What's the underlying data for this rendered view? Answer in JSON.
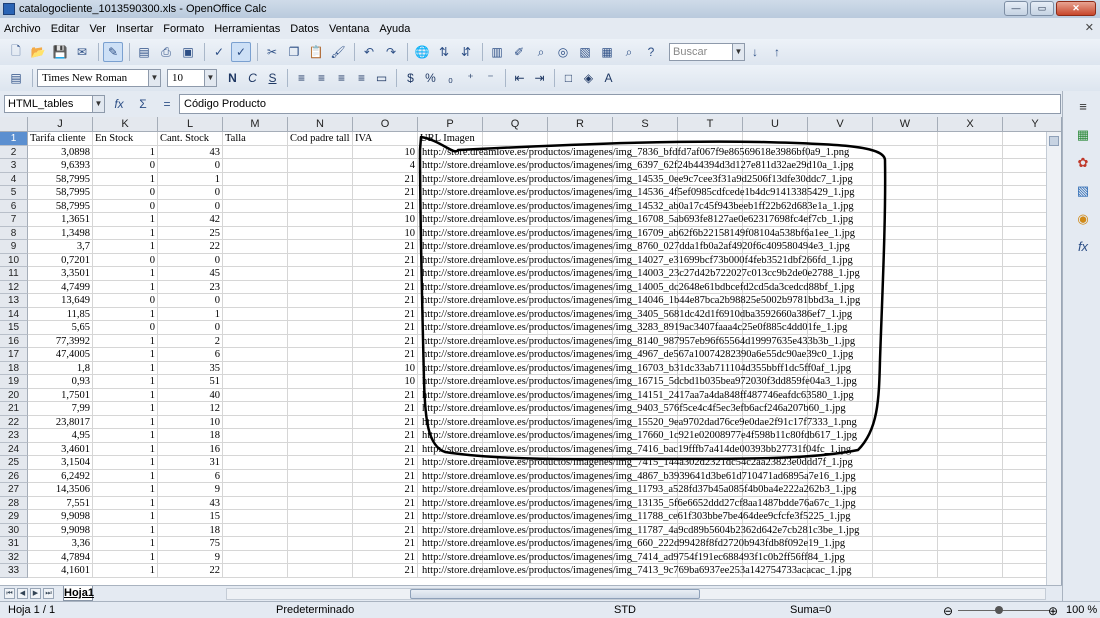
{
  "window": {
    "title": "catalogocliente_1013590300.xls - OpenOffice Calc",
    "minimize_label": "—",
    "maximize_label": "▭",
    "close_label": "✕"
  },
  "menu": {
    "items": [
      "Archivo",
      "Editar",
      "Ver",
      "Insertar",
      "Formato",
      "Herramientas",
      "Datos",
      "Ventana",
      "Ayuda"
    ],
    "close_label": "✕"
  },
  "toolbar": {
    "search_placeholder": "Buscar",
    "font_name": "Times New Roman",
    "font_size": "10",
    "bold_label": "N",
    "italic_label": "C",
    "underline_label": "S"
  },
  "formula_bar": {
    "name_box": "HTML_tables",
    "fx_label": "fx",
    "sum_label": "Σ",
    "equals_label": "=",
    "content": "Código Producto"
  },
  "columns": [
    "J",
    "K",
    "L",
    "M",
    "N",
    "O",
    "P",
    "Q",
    "R",
    "S",
    "T",
    "U",
    "V",
    "W",
    "X",
    "Y"
  ],
  "header_row": {
    "row_number": "1",
    "tarifa": "Tarifa cliente",
    "en_stock": "En Stock",
    "cant_stock": "Cant. Stock",
    "talla": "Talla",
    "cod_padre": "Cod padre tall",
    "iva": "IVA",
    "url": "URL Imagen"
  },
  "rows": [
    {
      "n": "2",
      "tarifa": "3,0898",
      "en_stock": "1",
      "cant": "43",
      "iva": "10",
      "url": "http://store.dreamlove.es/productos/imagenes/img_7836_bfdfd7af067f9e86569618e3986bf0a9_1.png"
    },
    {
      "n": "3",
      "tarifa": "9,6393",
      "en_stock": "0",
      "cant": "0",
      "iva": "4",
      "url": "http://store.dreamlove.es/productos/imagenes/img_6397_62f24b44394d3d127e811d32ae29d10a_1.jpg"
    },
    {
      "n": "4",
      "tarifa": "58,7995",
      "en_stock": "1",
      "cant": "1",
      "iva": "21",
      "url": "http://store.dreamlove.es/productos/imagenes/img_14535_0ee9c7cee3f31a9d2506f13dfe30ddc7_1.jpg"
    },
    {
      "n": "5",
      "tarifa": "58,7995",
      "en_stock": "0",
      "cant": "0",
      "iva": "21",
      "url": "http://store.dreamlove.es/productos/imagenes/img_14536_4f5ef0985cdfcede1b4dc91413385429_1.jpg"
    },
    {
      "n": "6",
      "tarifa": "58,7995",
      "en_stock": "0",
      "cant": "0",
      "iva": "21",
      "url": "http://store.dreamlove.es/productos/imagenes/img_14532_ab0a17c45f943beeb1ff22b62d683e1a_1.jpg"
    },
    {
      "n": "7",
      "tarifa": "1,3651",
      "en_stock": "1",
      "cant": "42",
      "iva": "10",
      "url": "http://store.dreamlove.es/productos/imagenes/img_16708_5ab693fe8127ae0e62317698fc4ef7cb_1.jpg"
    },
    {
      "n": "8",
      "tarifa": "1,3498",
      "en_stock": "1",
      "cant": "25",
      "iva": "10",
      "url": "http://store.dreamlove.es/productos/imagenes/img_16709_ab62f6b22158149f08104a538bf6a1ee_1.jpg"
    },
    {
      "n": "9",
      "tarifa": "3,7",
      "en_stock": "1",
      "cant": "22",
      "iva": "21",
      "url": "http://store.dreamlove.es/productos/imagenes/img_8760_027dda1fb0a2af4920f6c409580494e3_1.jpg"
    },
    {
      "n": "10",
      "tarifa": "0,7201",
      "en_stock": "0",
      "cant": "0",
      "iva": "21",
      "url": "http://store.dreamlove.es/productos/imagenes/img_14027_e31699bcf73b000f4feb3521dbf266fd_1.jpg"
    },
    {
      "n": "11",
      "tarifa": "3,3501",
      "en_stock": "1",
      "cant": "45",
      "iva": "21",
      "url": "http://store.dreamlove.es/productos/imagenes/img_14003_23c27d42b722027c013cc9b2de0e2788_1.jpg"
    },
    {
      "n": "12",
      "tarifa": "4,7499",
      "en_stock": "1",
      "cant": "23",
      "iva": "21",
      "url": "http://store.dreamlove.es/productos/imagenes/img_14005_dc2648e61bdbcefd2cd5da3cedcd88bf_1.jpg"
    },
    {
      "n": "13",
      "tarifa": "13,649",
      "en_stock": "0",
      "cant": "0",
      "iva": "21",
      "url": "http://store.dreamlove.es/productos/imagenes/img_14046_1b44e87bca2b98825e5002b9781bbd3a_1.jpg"
    },
    {
      "n": "14",
      "tarifa": "11,85",
      "en_stock": "1",
      "cant": "1",
      "iva": "21",
      "url": "http://store.dreamlove.es/productos/imagenes/img_3405_5681dc42d1f6910dba3592660a386ef7_1.jpg"
    },
    {
      "n": "15",
      "tarifa": "5,65",
      "en_stock": "0",
      "cant": "0",
      "iva": "21",
      "url": "http://store.dreamlove.es/productos/imagenes/img_3283_8919ac3407faaa4c25e0f885c4dd01fe_1.jpg"
    },
    {
      "n": "16",
      "tarifa": "77,3992",
      "en_stock": "1",
      "cant": "2",
      "iva": "21",
      "url": "http://store.dreamlove.es/productos/imagenes/img_8140_987957eb96f65564d19997635e433b3b_1.jpg"
    },
    {
      "n": "17",
      "tarifa": "47,4005",
      "en_stock": "1",
      "cant": "6",
      "iva": "21",
      "url": "http://store.dreamlove.es/productos/imagenes/img_4967_de567a10074282390a6e55dc90ae39c0_1.jpg"
    },
    {
      "n": "18",
      "tarifa": "1,8",
      "en_stock": "1",
      "cant": "35",
      "iva": "10",
      "url": "http://store.dreamlove.es/productos/imagenes/img_16703_b31dc33ab711104d355bbff1dc5ff0af_1.jpg"
    },
    {
      "n": "19",
      "tarifa": "0,93",
      "en_stock": "1",
      "cant": "51",
      "iva": "10",
      "url": "http://store.dreamlove.es/productos/imagenes/img_16715_5dcbd1b035bea972030f3dd859fe04a3_1.jpg"
    },
    {
      "n": "20",
      "tarifa": "1,7501",
      "en_stock": "1",
      "cant": "40",
      "iva": "21",
      "url": "http://store.dreamlove.es/productos/imagenes/img_14151_2417aa7a4da848ff487746eafdc63580_1.jpg"
    },
    {
      "n": "21",
      "tarifa": "7,99",
      "en_stock": "1",
      "cant": "12",
      "iva": "21",
      "url": "http://store.dreamlove.es/productos/imagenes/img_9403_576f5ce4c4f5ec3efb6acf246a207b60_1.jpg"
    },
    {
      "n": "22",
      "tarifa": "23,8017",
      "en_stock": "1",
      "cant": "10",
      "iva": "21",
      "url": "http://store.dreamlove.es/productos/imagenes/img_15520_9ea9702dad76ce9e0dae2f91c17f7333_1.png"
    },
    {
      "n": "23",
      "tarifa": "4,95",
      "en_stock": "1",
      "cant": "18",
      "iva": "21",
      "url": "http://store.dreamlove.es/productos/imagenes/img_17660_1c921e02008977e4f598b11c80fdb617_1.jpg"
    },
    {
      "n": "24",
      "tarifa": "3,4601",
      "en_stock": "1",
      "cant": "16",
      "iva": "21",
      "url": "http://store.dreamlove.es/productos/imagenes/img_7416_bac19fffb7a414de00393bb27731f04fc_1.jpg"
    },
    {
      "n": "25",
      "tarifa": "3,1504",
      "en_stock": "1",
      "cant": "31",
      "iva": "21",
      "url": "http://store.dreamlove.es/productos/imagenes/img_7415_144a302d2321dc54c2aa23823e0ddd7f_1.jpg"
    },
    {
      "n": "26",
      "tarifa": "6,2492",
      "en_stock": "1",
      "cant": "6",
      "iva": "21",
      "url": "http://store.dreamlove.es/productos/imagenes/img_4867_b3939641d3be61d710471ad6895a7e16_1.jpg"
    },
    {
      "n": "27",
      "tarifa": "14,3506",
      "en_stock": "1",
      "cant": "9",
      "iva": "21",
      "url": "http://store.dreamlove.es/productos/imagenes/img_11793_a528fd37b45a085f4b0ba4e222a262b3_1.jpg"
    },
    {
      "n": "28",
      "tarifa": "7,551",
      "en_stock": "1",
      "cant": "43",
      "iva": "21",
      "url": "http://store.dreamlove.es/productos/imagenes/img_13135_5f6e6652ddd27cf8aa1487bdde76a67c_1.jpg"
    },
    {
      "n": "29",
      "tarifa": "9,9098",
      "en_stock": "1",
      "cant": "15",
      "iva": "21",
      "url": "http://store.dreamlove.es/productos/imagenes/img_11788_ce61f303bbe7be464dee9cfcfe3f5225_1.jpg"
    },
    {
      "n": "30",
      "tarifa": "9,9098",
      "en_stock": "1",
      "cant": "18",
      "iva": "21",
      "url": "http://store.dreamlove.es/productos/imagenes/img_11787_4a9cd89b5604b2362d642e7cb281c3be_1.jpg"
    },
    {
      "n": "31",
      "tarifa": "3,36",
      "en_stock": "1",
      "cant": "75",
      "iva": "21",
      "url": "http://store.dreamlove.es/productos/imagenes/img_660_222d99428f8fd2720b943fdb8f092e19_1.jpg"
    },
    {
      "n": "32",
      "tarifa": "4,7894",
      "en_stock": "1",
      "cant": "9",
      "iva": "21",
      "url": "http://store.dreamlove.es/productos/imagenes/img_7414_ad9754f191ec688493f1c0b2ff56ff84_1.jpg"
    },
    {
      "n": "33",
      "tarifa": "4,1601",
      "en_stock": "1",
      "cant": "22",
      "iva": "21",
      "url": "http://store.dreamlove.es/productos/imagenes/img_7413_9c769ba6937ee253a142754733acacac_1.jpg"
    }
  ],
  "sheet_tabs": {
    "active": "Hoja1"
  },
  "statusbar": {
    "sheet": "Hoja 1 / 1",
    "style": "Predeterminado",
    "mode": "STD",
    "sum": "Suma=0",
    "zoom": "100 %"
  }
}
